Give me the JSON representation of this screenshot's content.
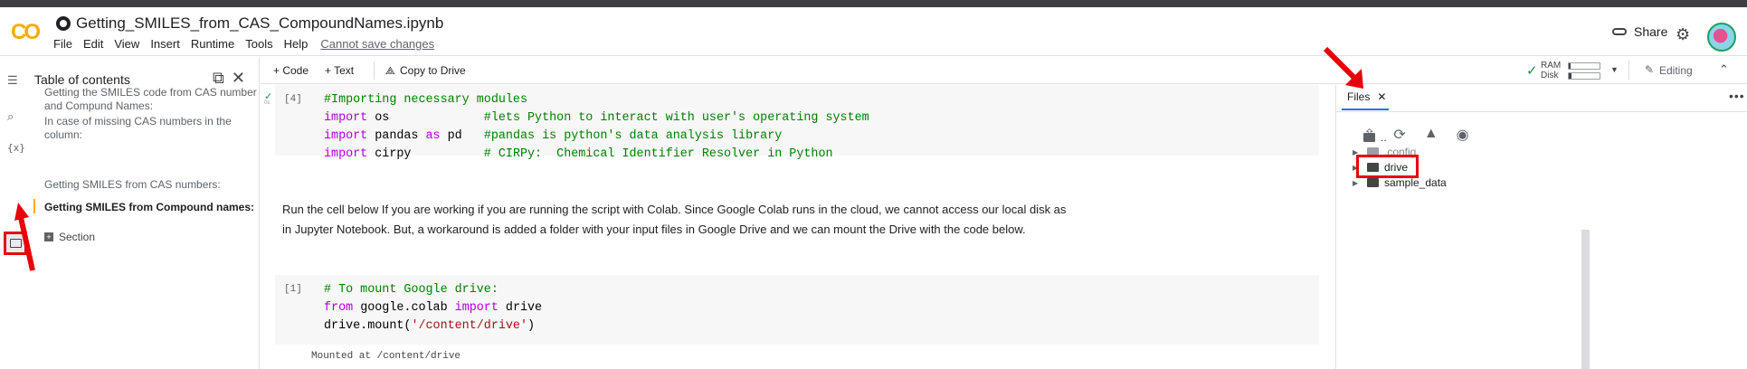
{
  "header": {
    "logo": "CO",
    "notebook_title": "Getting_SMILES_from_CAS_CompoundNames.ipynb",
    "menu": [
      "File",
      "Edit",
      "View",
      "Insert",
      "Runtime",
      "Tools",
      "Help"
    ],
    "save_notice": "Cannot save changes",
    "share_label": "Share"
  },
  "toc": {
    "title": "Table of contents",
    "items": [
      "Getting the SMILES code from CAS number and Compund Names:",
      "In case of missing CAS numbers in the column:",
      "Getting SMILES from CAS numbers:",
      "Getting SMILES from Compound names:"
    ],
    "section_label": "Section"
  },
  "toolbar": {
    "code_label": "+ Code",
    "text_label": "+ Text",
    "copy_label": "Copy to Drive",
    "ram_label": "RAM",
    "disk_label": "Disk",
    "ram_usage": 0.05,
    "disk_usage": 0.1,
    "editing_label": "Editing"
  },
  "cells": {
    "cell1": {
      "number": "[4]",
      "lines": [
        {
          "parts": [
            {
              "t": "#Importing necessary modules",
              "c": "cm"
            }
          ]
        },
        {
          "parts": [
            {
              "t": "import",
              "c": "kw"
            },
            {
              "t": " os             ",
              "c": ""
            },
            {
              "t": "#lets Python to interact with user's operating system",
              "c": "cm"
            }
          ]
        },
        {
          "parts": [
            {
              "t": "import",
              "c": "kw"
            },
            {
              "t": " pandas ",
              "c": ""
            },
            {
              "t": "as",
              "c": "kw"
            },
            {
              "t": " pd   ",
              "c": ""
            },
            {
              "t": "#pandas is python's data analysis library",
              "c": "cm"
            }
          ]
        },
        {
          "parts": [
            {
              "t": "import",
              "c": "kw"
            },
            {
              "t": " cirpy          ",
              "c": ""
            },
            {
              "t": "# CIRPy:  Chemical Identifier Resolver in Python",
              "c": "cm"
            }
          ]
        }
      ]
    },
    "markdown": "Run the cell below If you are working if you are running the script with Colab. Since Google Colab runs in the cloud, we cannot access our local disk as in Jupyter Notebook. But, a workaround is added a folder with your input files in Google Drive and we can mount the Drive with the code below.",
    "cell2": {
      "number": "[1]",
      "lines": [
        {
          "parts": [
            {
              "t": "# To mount Google drive:",
              "c": "cm"
            }
          ]
        },
        {
          "parts": [
            {
              "t": "from",
              "c": "kw"
            },
            {
              "t": " google.colab ",
              "c": ""
            },
            {
              "t": "import",
              "c": "kw"
            },
            {
              "t": " drive",
              "c": ""
            }
          ]
        },
        {
          "parts": [
            {
              "t": "drive.mount(",
              "c": ""
            },
            {
              "t": "'/content/drive'",
              "c": "st"
            },
            {
              "t": ")",
              "c": ""
            }
          ]
        }
      ],
      "output": "Mounted at /content/drive"
    }
  },
  "files": {
    "tab_label": "Files",
    "tree": [
      {
        "name": "..",
        "kind": "up"
      },
      {
        "name": ".config",
        "kind": "folder"
      },
      {
        "name": "drive",
        "kind": "folder"
      },
      {
        "name": "sample_data",
        "kind": "folder"
      }
    ]
  },
  "colors": {
    "accent": "#f9ab00",
    "highlight_red": "#e8000b",
    "comment_green": "#008000",
    "keyword_purple": "#af00db"
  }
}
